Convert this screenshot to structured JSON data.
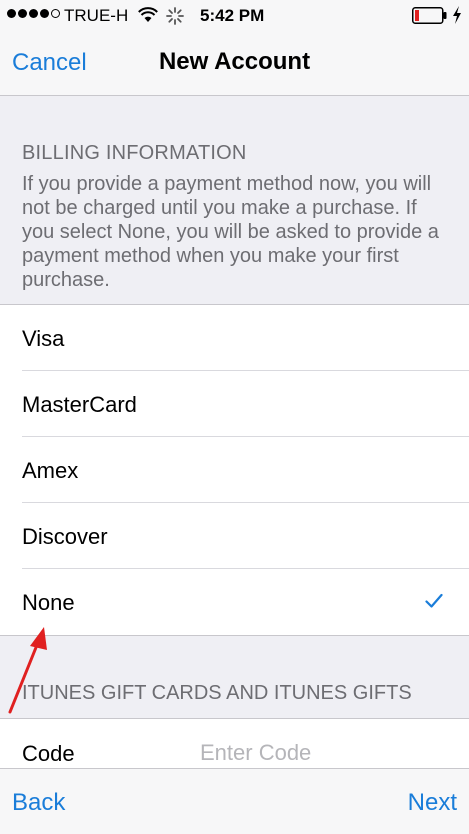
{
  "status_bar": {
    "carrier": "TRUE-H",
    "time": "5:42 PM",
    "signal_bars_filled": 4,
    "signal_bars_total": 5
  },
  "nav": {
    "cancel_label": "Cancel",
    "title": "New Account"
  },
  "billing": {
    "title": "BILLING INFORMATION",
    "description": "If you provide a payment method now, you will not be charged until you make a purchase. If you select None, you will be asked to provide a payment method when you make your first purchase.",
    "options": [
      {
        "label": "Visa",
        "selected": false
      },
      {
        "label": "MasterCard",
        "selected": false
      },
      {
        "label": "Amex",
        "selected": false
      },
      {
        "label": "Discover",
        "selected": false
      },
      {
        "label": "None",
        "selected": true
      }
    ]
  },
  "gift": {
    "title": "ITUNES GIFT CARDS AND ITUNES GIFTS",
    "code_label": "Code",
    "code_placeholder": "Enter Code",
    "code_value": ""
  },
  "toolbar": {
    "back_label": "Back",
    "next_label": "Next"
  },
  "colors": {
    "accent": "#1a7dd9",
    "annotation_arrow": "#e02020",
    "battery_low": "#e02020"
  }
}
